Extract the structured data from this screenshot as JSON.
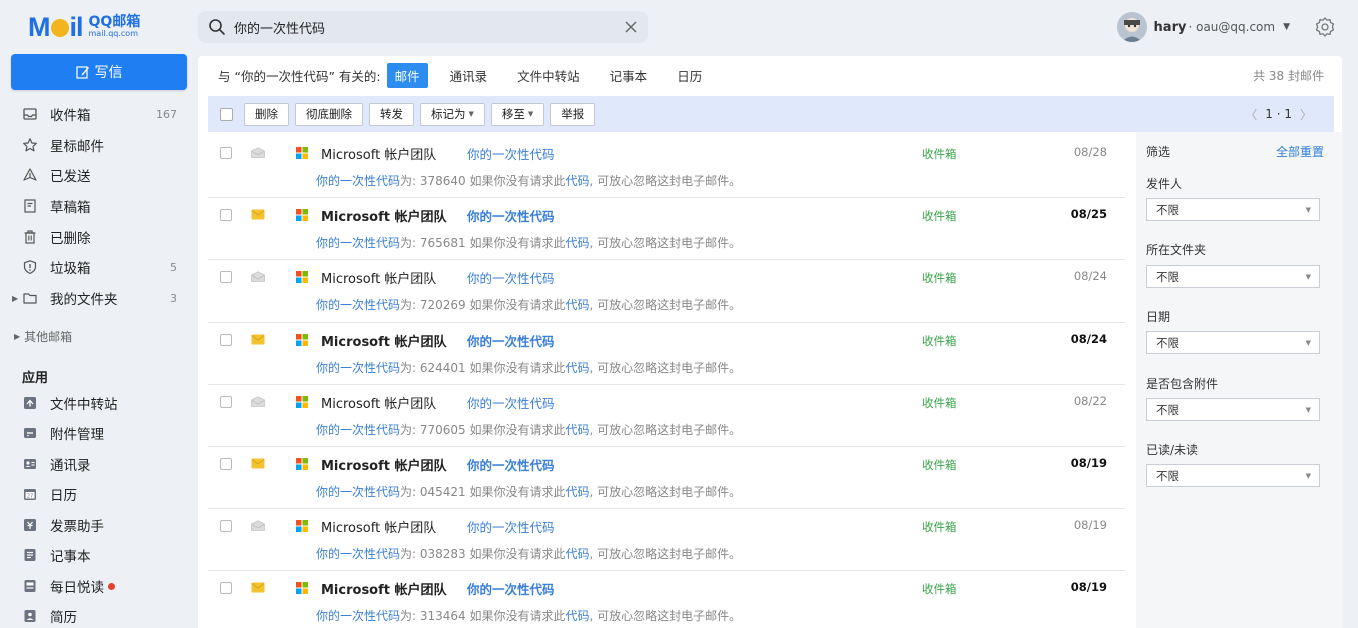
{
  "brand": {
    "logo_main": "MAil",
    "logo_title": "QQ邮箱",
    "logo_sub": "mail.qq.com"
  },
  "search": {
    "query": "你的一次性代码",
    "placeholder": ""
  },
  "account": {
    "name": "hary",
    "email": "· oau@qq.com"
  },
  "sidebar": {
    "compose": "写信",
    "items": [
      {
        "label": "收件箱",
        "count": "167"
      },
      {
        "label": "星标邮件",
        "count": ""
      },
      {
        "label": "已发送",
        "count": ""
      },
      {
        "label": "草稿箱",
        "count": ""
      },
      {
        "label": "已删除",
        "count": ""
      },
      {
        "label": "垃圾箱",
        "count": "5"
      },
      {
        "label": "我的文件夹",
        "count": "3"
      }
    ],
    "other_mail": "其他邮箱",
    "apps_heading": "应用",
    "apps": [
      {
        "label": "文件中转站"
      },
      {
        "label": "附件管理"
      },
      {
        "label": "通讯录"
      },
      {
        "label": "日历"
      },
      {
        "label": "发票助手"
      },
      {
        "label": "记事本"
      },
      {
        "label": "每日悦读"
      },
      {
        "label": "简历"
      }
    ]
  },
  "related": {
    "prefix": "与 “你的一次性代码” 有关的:",
    "tabs": [
      "邮件",
      "通讯录",
      "文件中转站",
      "记事本",
      "日历"
    ],
    "total": "共 38 封邮件"
  },
  "toolbar": {
    "delete": "删除",
    "perm_delete": "彻底删除",
    "forward": "转发",
    "mark_as": "标记为",
    "move_to": "移至",
    "report": "举报",
    "page": "1 · 1"
  },
  "mails": [
    {
      "sender": "Microsoft 帐户团队",
      "subject": "你的一次性代码",
      "folder": "收件箱",
      "date": "08/28",
      "code_prefix": "你的一次性代码",
      "code_text": "为: 378640 如果你没有请求此",
      "code_word": "代码",
      "tail": ", 可放心忽略这封电子邮件。",
      "unread": false
    },
    {
      "sender": "Microsoft 帐户团队",
      "subject": "你的一次性代码",
      "folder": "收件箱",
      "date": "08/25",
      "code_prefix": "你的一次性代码",
      "code_text": "为: 765681 如果你没有请求此",
      "code_word": "代码",
      "tail": ", 可放心忽略这封电子邮件。",
      "unread": true
    },
    {
      "sender": "Microsoft 帐户团队",
      "subject": "你的一次性代码",
      "folder": "收件箱",
      "date": "08/24",
      "code_prefix": "你的一次性代码",
      "code_text": "为: 720269 如果你没有请求此",
      "code_word": "代码",
      "tail": ", 可放心忽略这封电子邮件。",
      "unread": false
    },
    {
      "sender": "Microsoft 帐户团队",
      "subject": "你的一次性代码",
      "folder": "收件箱",
      "date": "08/24",
      "code_prefix": "你的一次性代码",
      "code_text": "为: 624401 如果你没有请求此",
      "code_word": "代码",
      "tail": ", 可放心忽略这封电子邮件。",
      "unread": true
    },
    {
      "sender": "Microsoft 帐户团队",
      "subject": "你的一次性代码",
      "folder": "收件箱",
      "date": "08/22",
      "code_prefix": "你的一次性代码",
      "code_text": "为: 770605 如果你没有请求此",
      "code_word": "代码",
      "tail": ", 可放心忽略这封电子邮件。",
      "unread": false
    },
    {
      "sender": "Microsoft 帐户团队",
      "subject": "你的一次性代码",
      "folder": "收件箱",
      "date": "08/19",
      "code_prefix": "你的一次性代码",
      "code_text": "为: 045421 如果你没有请求此",
      "code_word": "代码",
      "tail": ", 可放心忽略这封电子邮件。",
      "unread": true
    },
    {
      "sender": "Microsoft 帐户团队",
      "subject": "你的一次性代码",
      "folder": "收件箱",
      "date": "08/19",
      "code_prefix": "你的一次性代码",
      "code_text": "为: 038283 如果你没有请求此",
      "code_word": "代码",
      "tail": ", 可放心忽略这封电子邮件。",
      "unread": false
    },
    {
      "sender": "Microsoft 帐户团队",
      "subject": "你的一次性代码",
      "folder": "收件箱",
      "date": "08/19",
      "code_prefix": "你的一次性代码",
      "code_text": "为: 313464 如果你没有请求此",
      "code_word": "代码",
      "tail": ", 可放心忽略这封电子邮件。",
      "unread": true
    }
  ],
  "filter": {
    "title": "筛选",
    "reset": "全部重置",
    "groups": [
      {
        "label": "发件人",
        "value": "不限"
      },
      {
        "label": "所在文件夹",
        "value": "不限"
      },
      {
        "label": "日期",
        "value": "不限"
      },
      {
        "label": "是否包含附件",
        "value": "不限"
      },
      {
        "label": "已读/未读",
        "value": "不限"
      }
    ]
  },
  "colors": {
    "accent": "#1f7ef2",
    "link": "#3a7fd6",
    "folder_green": "#3aa64a",
    "toolbar_bg": "#dfe9fb"
  }
}
